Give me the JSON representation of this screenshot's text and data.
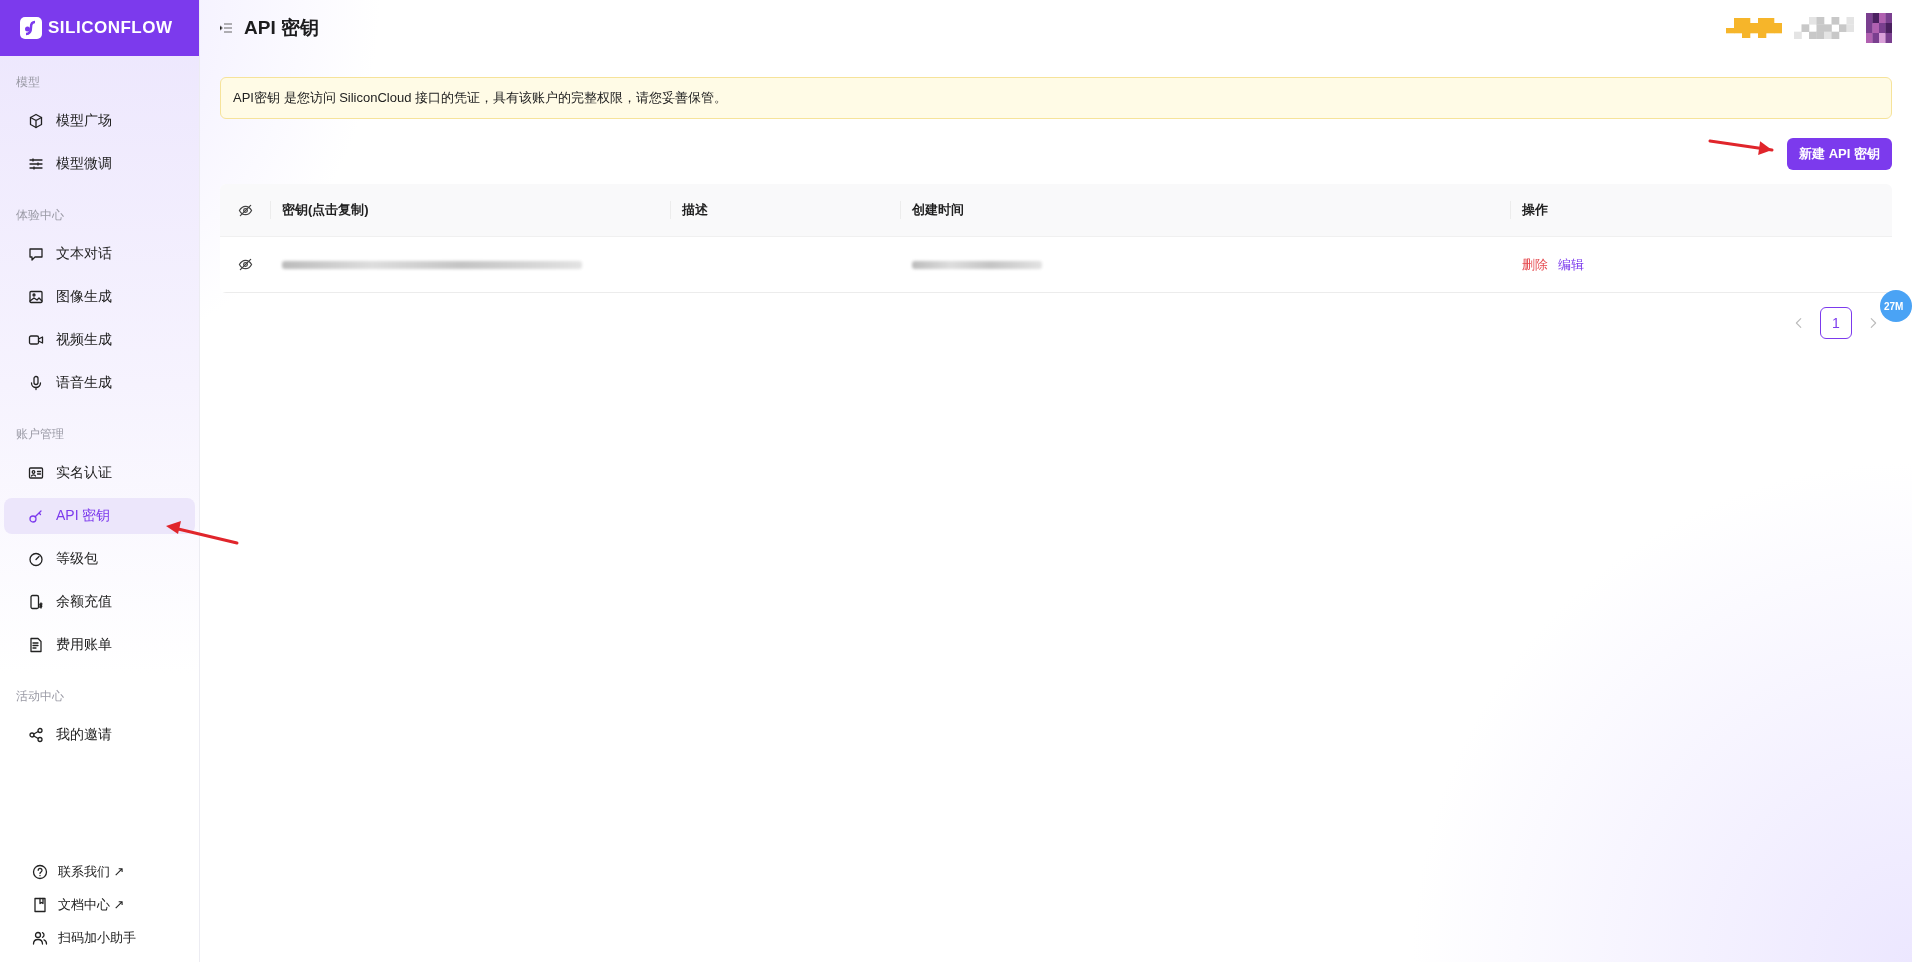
{
  "sidebar": {
    "logo": "SILICONFLOW",
    "sections": [
      {
        "title": "模型",
        "items": [
          {
            "label": "模型广场",
            "selected": false
          },
          {
            "label": "模型微调",
            "selected": false
          }
        ]
      },
      {
        "title": "体验中心",
        "items": [
          {
            "label": "文本对话",
            "selected": false
          },
          {
            "label": "图像生成",
            "selected": false
          },
          {
            "label": "视频生成",
            "selected": false
          },
          {
            "label": "语音生成",
            "selected": false
          }
        ]
      },
      {
        "title": "账户管理",
        "items": [
          {
            "label": "实名认证",
            "selected": false
          },
          {
            "label": "API 密钥",
            "selected": true
          },
          {
            "label": "等级包",
            "selected": false
          },
          {
            "label": "余额充值",
            "selected": false
          },
          {
            "label": "费用账单",
            "selected": false
          }
        ]
      },
      {
        "title": "活动中心",
        "items": [
          {
            "label": "我的邀请",
            "selected": false
          }
        ]
      }
    ],
    "footer_links": [
      {
        "label": "联系我们 ↗"
      },
      {
        "label": "文档中心 ↗"
      },
      {
        "label": "扫码加小助手"
      }
    ]
  },
  "header": {
    "title": "API 密钥"
  },
  "notice": "API密钥 是您访问 SiliconCloud 接口的凭证，具有该账户的完整权限，请您妥善保管。",
  "create_button": "新建 API 密钥",
  "table": {
    "columns": [
      {
        "kind": "icon"
      },
      {
        "kind": "text",
        "label": "密钥(点击复制)"
      },
      {
        "kind": "text",
        "label": "描述"
      },
      {
        "kind": "text",
        "label": "创建时间"
      },
      {
        "kind": "text",
        "label": "操作"
      }
    ],
    "rows": [
      {
        "masked": true,
        "actions": [
          {
            "label": "删除",
            "color": "#e5484d"
          },
          {
            "label": "编辑",
            "color": "#7c3aed"
          }
        ]
      }
    ]
  },
  "pagination": {
    "pages": [
      {
        "label": "1",
        "selected": true
      }
    ]
  },
  "badge": "27M"
}
